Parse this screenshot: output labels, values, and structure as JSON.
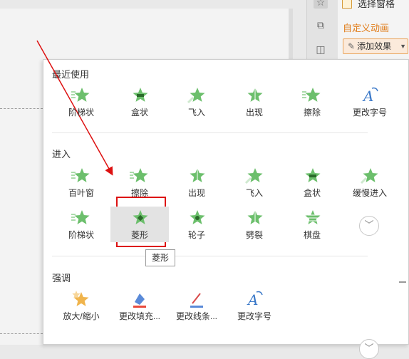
{
  "pane": {
    "selection_pane_label": "选择窗格",
    "custom_animation_title": "自定义动画",
    "add_effect_label": "添加效果"
  },
  "recent": {
    "title": "最近使用",
    "items": [
      {
        "label": "阶梯状",
        "icon": "steps-star-icon"
      },
      {
        "label": "盒状",
        "icon": "box-star-icon"
      },
      {
        "label": "飞入",
        "icon": "fly-in-star-icon"
      },
      {
        "label": "出现",
        "icon": "appear-star-icon"
      },
      {
        "label": "擦除",
        "icon": "wipe-star-icon"
      },
      {
        "label": "更改字号",
        "icon": "change-font-size-icon"
      }
    ]
  },
  "entrance": {
    "title": "进入",
    "items": [
      {
        "label": "百叶窗",
        "icon": "blinds-star-icon"
      },
      {
        "label": "擦除",
        "icon": "wipe-star-icon"
      },
      {
        "label": "出现",
        "icon": "appear-star-icon"
      },
      {
        "label": "飞入",
        "icon": "fly-in-star-icon"
      },
      {
        "label": "盒状",
        "icon": "box-star-icon"
      },
      {
        "label": "缓慢进入",
        "icon": "slow-enter-star-icon"
      },
      {
        "label": "阶梯状",
        "icon": "steps-star-icon"
      },
      {
        "label": "菱形",
        "icon": "diamond-star-icon"
      },
      {
        "label": "轮子",
        "icon": "wheel-star-icon"
      },
      {
        "label": "劈裂",
        "icon": "split-star-icon"
      },
      {
        "label": "棋盘",
        "icon": "checkerboard-star-icon"
      }
    ]
  },
  "emphasis": {
    "title": "强调",
    "items": [
      {
        "label": "放大/缩小",
        "icon": "grow-shrink-icon"
      },
      {
        "label": "更改填充...",
        "icon": "change-fill-icon"
      },
      {
        "label": "更改线条...",
        "icon": "change-line-icon"
      },
      {
        "label": "更改字号",
        "icon": "change-font-size-icon"
      }
    ]
  },
  "tooltip": "菱形",
  "colors": {
    "green_star": "#6cbf6c",
    "orange_accent": "#e07b18",
    "highlight_box": "#dd1111"
  }
}
